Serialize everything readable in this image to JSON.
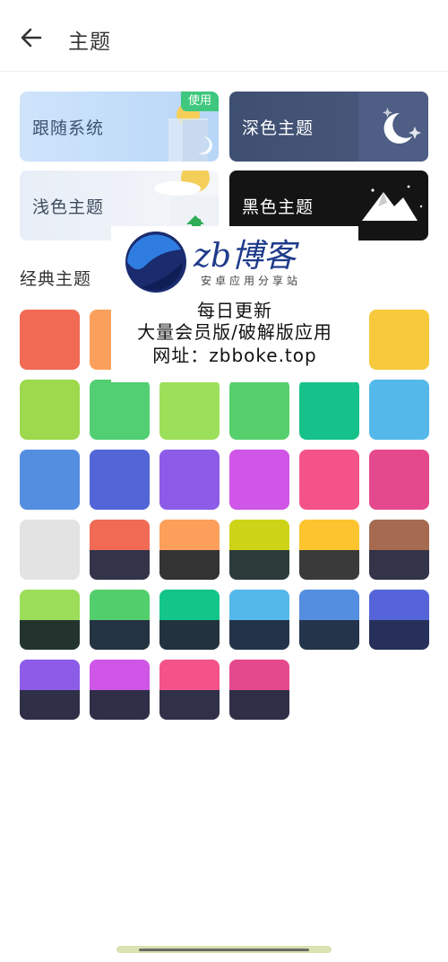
{
  "header": {
    "title": "主题",
    "back_icon": "arrow-left-icon"
  },
  "modes": [
    {
      "label": "跟随系统",
      "badge": "使用"
    },
    {
      "label": "深色主题"
    },
    {
      "label": "浅色主题"
    },
    {
      "label": "黑色主题"
    }
  ],
  "section_title": "经典主题",
  "swatches": [
    {
      "top": "#f06a54"
    },
    {
      "top": "#fba05c"
    },
    {
      "top": "#f7c93c"
    },
    {
      "top": "#9dd84d"
    },
    {
      "top": "#52cf72"
    },
    {
      "top": "#9ce05a"
    },
    {
      "top": "#56d06c"
    },
    {
      "top": "#16c28a"
    },
    {
      "top": "#55b8ea"
    },
    {
      "top": "#538ee0"
    },
    {
      "top": "#5465d8"
    },
    {
      "top": "#8c5ce8"
    },
    {
      "top": "#cf56e6"
    },
    {
      "top": "#f4538a"
    },
    {
      "top": "#e5498d"
    },
    {
      "top": "#e3e3e3"
    },
    {
      "top": "#f06a54",
      "bottom": "#33334a"
    },
    {
      "top": "#fb9f5b",
      "bottom": "#333333"
    },
    {
      "top": "#cdd418",
      "bottom": "#2c3a3a"
    },
    {
      "top": "#fcc42f",
      "bottom": "#3a3a3a"
    },
    {
      "top": "#a56a50",
      "bottom": "#333349"
    },
    {
      "top": "#9cde5a",
      "bottom": "#23342e"
    },
    {
      "top": "#52cf6c",
      "bottom": "#243342"
    },
    {
      "top": "#14c58a",
      "bottom": "#22323f"
    },
    {
      "top": "#55b8ea",
      "bottom": "#23344a"
    },
    {
      "top": "#538ee0",
      "bottom": "#24344a"
    },
    {
      "top": "#5565d9",
      "bottom": "#26305a"
    },
    {
      "top": "#8c5ce8",
      "bottom": "#302f48"
    },
    {
      "top": "#cf56e6",
      "bottom": "#2f2f48"
    },
    {
      "top": "#f4538a",
      "bottom": "#303049"
    },
    {
      "top": "#e5498d",
      "bottom": "#2f2f48"
    }
  ],
  "watermark": {
    "brand": "zb博客",
    "subtitle": "安卓应用分享站",
    "line1": "每日更新",
    "line2": "大量会员版/破解版应用",
    "line3": "网址：zbboke.top"
  }
}
